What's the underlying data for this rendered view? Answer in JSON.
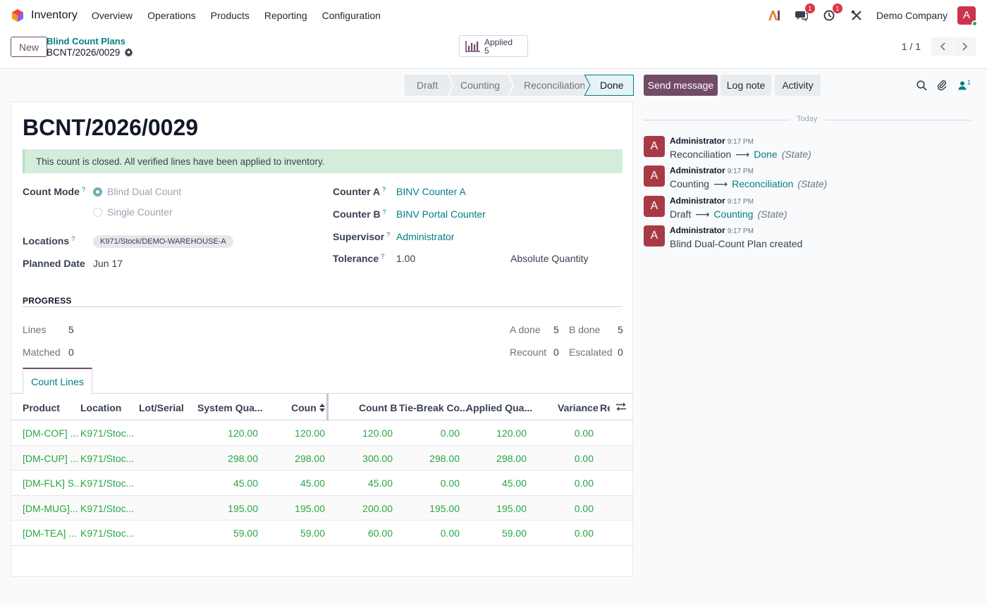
{
  "navbar": {
    "app_name": "Inventory",
    "menu": [
      "Overview",
      "Operations",
      "Products",
      "Reporting",
      "Configuration"
    ],
    "messages_badge": "1",
    "activities_badge": "1",
    "company": "Demo Company",
    "avatar_letter": "A"
  },
  "control": {
    "new_label": "New",
    "breadcrumb": "Blind Count Plans",
    "record": "BCNT/2026/0029",
    "smart_button": {
      "label": "Applied",
      "value": "5"
    },
    "pager": "1 / 1"
  },
  "statusbar": {
    "stages": [
      "Draft",
      "Counting",
      "Reconciliation",
      "Done"
    ],
    "current": "Done"
  },
  "form": {
    "title": "BCNT/2026/0029",
    "alert": "This count is closed. All verified lines have been applied to inventory.",
    "count_mode_label": "Count Mode",
    "count_mode_options": [
      "Blind Dual Count",
      "Single Counter"
    ],
    "count_mode_selected": "Blind Dual Count",
    "locations_label": "Locations",
    "location_tag": "K971/Stock/DEMO-WAREHOUSE-A",
    "planned_date_label": "Planned Date",
    "planned_date": "Jun 17",
    "counter_a_label": "Counter A",
    "counter_a": "BINV Counter A",
    "counter_b_label": "Counter B",
    "counter_b": "BINV Portal Counter",
    "supervisor_label": "Supervisor",
    "supervisor": "Administrator",
    "tolerance_label": "Tolerance",
    "tolerance": "1.00",
    "tolerance_type": "Absolute Quantity",
    "help_mark": "?"
  },
  "progress": {
    "title": "PROGRESS",
    "lines_label": "Lines",
    "lines": "5",
    "matched_label": "Matched",
    "matched": "0",
    "a_done_label": "A done",
    "a_done": "5",
    "b_done_label": "B done",
    "b_done": "5",
    "recount_label": "Recount",
    "recount": "0",
    "escalated_label": "Escalated",
    "escalated": "0"
  },
  "tabs": [
    "Count Lines"
  ],
  "table": {
    "headers": [
      "Product",
      "Location",
      "Lot/Serial",
      "System Qua...",
      "Coun",
      "Count B",
      "Tie-Break Co...",
      "Applied Qua...",
      "Variance",
      "Re"
    ],
    "rows": [
      [
        "[DM-COF] ...",
        "K971/Stoc...",
        "",
        "120.00",
        "120.00",
        "120.00",
        "0.00",
        "120.00",
        "0.00"
      ],
      [
        "[DM-CUP] ...",
        "K971/Stoc...",
        "",
        "298.00",
        "298.00",
        "300.00",
        "298.00",
        "298.00",
        "0.00"
      ],
      [
        "[DM-FLK] S...",
        "K971/Stoc...",
        "",
        "45.00",
        "45.00",
        "45.00",
        "0.00",
        "45.00",
        "0.00"
      ],
      [
        "[DM-MUG]...",
        "K971/Stoc...",
        "",
        "195.00",
        "195.00",
        "200.00",
        "195.00",
        "195.00",
        "0.00"
      ],
      [
        "[DM-TEA] ...",
        "K971/Stoc...",
        "",
        "59.00",
        "59.00",
        "60.00",
        "0.00",
        "59.00",
        "0.00"
      ]
    ]
  },
  "chatter": {
    "send_message": "Send message",
    "log_note": "Log note",
    "activity": "Activity",
    "followers_count": "1",
    "today": "Today",
    "messages": [
      {
        "author": "Administrator",
        "time": "9:17 PM",
        "old": "Reconciliation",
        "new": "Done",
        "field": "(State)"
      },
      {
        "author": "Administrator",
        "time": "9:17 PM",
        "old": "Counting",
        "new": "Reconciliation",
        "field": "(State)"
      },
      {
        "author": "Administrator",
        "time": "9:17 PM",
        "old": "Draft",
        "new": "Counting",
        "field": "(State)"
      },
      {
        "author": "Administrator",
        "time": "9:17 PM",
        "text": "Blind Dual-Count Plan created"
      }
    ]
  },
  "colors": {
    "brand": "#714b67",
    "link": "#017e84",
    "success_text": "#28a745",
    "alert_bg": "#d4edda"
  }
}
